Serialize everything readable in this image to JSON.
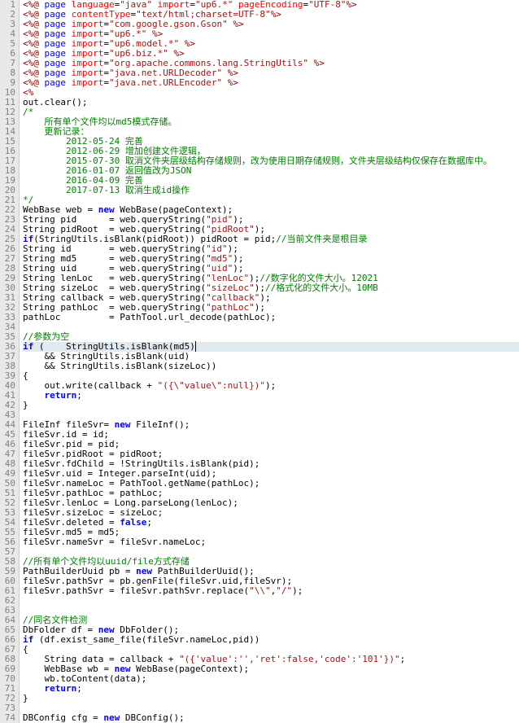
{
  "lines": [
    {
      "n": 1,
      "cls": "",
      "html": "<span class='tag'>&lt;%@</span> <span class='dir'>page</span> <span class='attr'>language</span>=<span class='str'>\"java\"</span> <span class='attr'>import</span>=<span class='str'>\"up6.*\"</span> <span class='attr'>pageEncoding</span>=<span class='str'>\"UTF-8\"</span><span class='tag'>%&gt;</span>"
    },
    {
      "n": 2,
      "cls": "",
      "html": "<span class='tag'>&lt;%@</span> <span class='dir'>page</span> <span class='attr'>contentType</span>=<span class='str'>\"text/html;charset=UTF-8\"</span><span class='tag'>%&gt;</span>"
    },
    {
      "n": 3,
      "cls": "",
      "html": "<span class='tag'>&lt;%@</span> <span class='dir'>page</span> <span class='attr'>import</span>=<span class='str'>\"com.google.gson.Gson\"</span> <span class='tag'>%&gt;</span>"
    },
    {
      "n": 4,
      "cls": "",
      "html": "<span class='tag'>&lt;%@</span> <span class='dir'>page</span> <span class='attr'>import</span>=<span class='str'>\"up6.*\"</span> <span class='tag'>%&gt;</span>"
    },
    {
      "n": 5,
      "cls": "",
      "html": "<span class='tag'>&lt;%@</span> <span class='dir'>page</span> <span class='attr'>import</span>=<span class='str'>\"up6.model.*\"</span> <span class='tag'>%&gt;</span>"
    },
    {
      "n": 6,
      "cls": "",
      "html": "<span class='tag'>&lt;%@</span> <span class='dir'>page</span> <span class='attr'>import</span>=<span class='str'>\"up6.biz.*\"</span> <span class='tag'>%&gt;</span>"
    },
    {
      "n": 7,
      "cls": "",
      "html": "<span class='tag'>&lt;%@</span> <span class='dir'>page</span> <span class='attr'>import</span>=<span class='str'>\"org.apache.commons.lang.StringUtils\"</span> <span class='tag'>%&gt;</span>"
    },
    {
      "n": 8,
      "cls": "",
      "html": "<span class='tag'>&lt;%@</span> <span class='dir'>page</span> <span class='attr'>import</span>=<span class='str'>\"java.net.URLDecoder\"</span> <span class='tag'>%&gt;</span>"
    },
    {
      "n": 9,
      "cls": "",
      "html": "<span class='tag'>&lt;%@</span> <span class='dir'>page</span> <span class='attr'>import</span>=<span class='str'>\"java.net.URLEncoder\"</span> <span class='tag'>%&gt;</span>"
    },
    {
      "n": 10,
      "cls": "",
      "html": "<span class='tag'>&lt;%</span>"
    },
    {
      "n": 11,
      "cls": "",
      "html": "out.clear();"
    },
    {
      "n": 12,
      "cls": "",
      "html": "<span class='cm'>/*</span>"
    },
    {
      "n": 13,
      "cls": "",
      "html": "<span class='cm'>    所有单个文件均以md5模式存储。</span>"
    },
    {
      "n": 14,
      "cls": "",
      "html": "<span class='cm'>    更新记录：</span>"
    },
    {
      "n": 15,
      "cls": "",
      "html": "<span class='cm'>        2012-05-24 完善</span>"
    },
    {
      "n": 16,
      "cls": "",
      "html": "<span class='cm'>        2012-06-29 增加创建文件逻辑，</span>"
    },
    {
      "n": 17,
      "cls": "",
      "html": "<span class='cm'>        2015-07-30 取消文件夹层级结构存储规则，改为使用日期存储规则，文件夹层级结构仅保存在数据库中。</span>"
    },
    {
      "n": 18,
      "cls": "",
      "html": "<span class='cm'>        2016-01-07 返回值改为JSON</span>"
    },
    {
      "n": 19,
      "cls": "",
      "html": "<span class='cm'>        2016-04-09 完善</span>"
    },
    {
      "n": 20,
      "cls": "",
      "html": "<span class='cm'>        2017-07-13 取消生成id操作</span>"
    },
    {
      "n": 21,
      "cls": "",
      "html": "<span class='cm'>*/</span>"
    },
    {
      "n": 22,
      "cls": "",
      "html": "WebBase web = <span class='kw'>new</span> WebBase(pageContext);"
    },
    {
      "n": 23,
      "cls": "",
      "html": "String pid      = web.queryString(<span class='str'>\"pid\"</span>);"
    },
    {
      "n": 24,
      "cls": "",
      "html": "String pidRoot  = web.queryString(<span class='str'>\"pidRoot\"</span>);"
    },
    {
      "n": 25,
      "cls": "",
      "html": "<span class='kw'>if</span>(StringUtils.isBlank(pidRoot)) pidRoot = pid;<span class='cm'>//当前文件夹是根目录</span>"
    },
    {
      "n": 26,
      "cls": "",
      "html": "String id       = web.queryString(<span class='str'>\"id\"</span>);"
    },
    {
      "n": 27,
      "cls": "",
      "html": "String md5      = web.queryString(<span class='str'>\"md5\"</span>);"
    },
    {
      "n": 28,
      "cls": "",
      "html": "String uid      = web.queryString(<span class='str'>\"uid\"</span>);"
    },
    {
      "n": 29,
      "cls": "",
      "html": "String lenLoc   = web.queryString(<span class='str'>\"lenLoc\"</span>);<span class='cm'>//数字化的文件大小。12021</span>"
    },
    {
      "n": 30,
      "cls": "",
      "html": "String sizeLoc  = web.queryString(<span class='str'>\"sizeLoc\"</span>);<span class='cm'>//格式化的文件大小。10MB</span>"
    },
    {
      "n": 31,
      "cls": "",
      "html": "String callback = web.queryString(<span class='str'>\"callback\"</span>);"
    },
    {
      "n": 32,
      "cls": "",
      "html": "String pathLoc  = web.queryString(<span class='str'>\"pathLoc\"</span>);"
    },
    {
      "n": 33,
      "cls": "",
      "html": "pathLoc         = PathTool.url_decode(pathLoc);"
    },
    {
      "n": 34,
      "cls": "",
      "html": ""
    },
    {
      "n": 35,
      "cls": "",
      "html": "<span class='cm'>//参数为空</span>"
    },
    {
      "n": 36,
      "cls": "hl",
      "html": "<span class='kw'>if</span> (    StringUtils.isBlank(md5)<span style='border-left:1px solid #000'></span>"
    },
    {
      "n": 37,
      "cls": "",
      "html": "    &amp;&amp; StringUtils.isBlank(uid)"
    },
    {
      "n": 38,
      "cls": "",
      "html": "    &amp;&amp; StringUtils.isBlank(sizeLoc))"
    },
    {
      "n": 39,
      "cls": "",
      "html": "{"
    },
    {
      "n": 40,
      "cls": "",
      "html": "    out.write(callback + <span class='str'>\"({\\\"value\\\":null})\"</span>);"
    },
    {
      "n": 41,
      "cls": "",
      "html": "    <span class='kw'>return</span>;"
    },
    {
      "n": 42,
      "cls": "",
      "html": "}"
    },
    {
      "n": 43,
      "cls": "",
      "html": ""
    },
    {
      "n": 44,
      "cls": "",
      "html": "FileInf fileSvr= <span class='kw'>new</span> FileInf();"
    },
    {
      "n": 45,
      "cls": "",
      "html": "fileSvr.id = id;"
    },
    {
      "n": 46,
      "cls": "",
      "html": "fileSvr.pid = pid;"
    },
    {
      "n": 47,
      "cls": "",
      "html": "fileSvr.pidRoot = pidRoot;"
    },
    {
      "n": 48,
      "cls": "",
      "html": "fileSvr.fdChild = !StringUtils.isBlank(pid);"
    },
    {
      "n": 49,
      "cls": "",
      "html": "fileSvr.uid = Integer.parseInt(uid);"
    },
    {
      "n": 50,
      "cls": "",
      "html": "fileSvr.nameLoc = PathTool.getName(pathLoc);"
    },
    {
      "n": 51,
      "cls": "",
      "html": "fileSvr.pathLoc = pathLoc;"
    },
    {
      "n": 52,
      "cls": "",
      "html": "fileSvr.lenLoc = Long.parseLong(lenLoc);"
    },
    {
      "n": 53,
      "cls": "",
      "html": "fileSvr.sizeLoc = sizeLoc;"
    },
    {
      "n": 54,
      "cls": "",
      "html": "fileSvr.deleted = <span class='kw'>false</span>;"
    },
    {
      "n": 55,
      "cls": "",
      "html": "fileSvr.md5 = md5;"
    },
    {
      "n": 56,
      "cls": "",
      "html": "fileSvr.nameSvr = fileSvr.nameLoc;"
    },
    {
      "n": 57,
      "cls": "",
      "html": ""
    },
    {
      "n": 58,
      "cls": "",
      "html": "<span class='cm'>//所有单个文件均以uuid/file方式存储</span>"
    },
    {
      "n": 59,
      "cls": "",
      "html": "PathBuilderUuid pb = <span class='kw'>new</span> PathBuilderUuid();"
    },
    {
      "n": 60,
      "cls": "",
      "html": "fileSvr.pathSvr = pb.genFile(fileSvr.uid,fileSvr);"
    },
    {
      "n": 61,
      "cls": "",
      "html": "fileSvr.pathSvr = fileSvr.pathSvr.replace(<span class='str'>\"\\\\\"</span>,<span class='str'>\"/\"</span>);"
    },
    {
      "n": 62,
      "cls": "",
      "html": ""
    },
    {
      "n": 63,
      "cls": "",
      "html": ""
    },
    {
      "n": 64,
      "cls": "",
      "html": "<span class='cm'>//同名文件检测</span>"
    },
    {
      "n": 65,
      "cls": "",
      "html": "DbFolder df = <span class='kw'>new</span> DbFolder();"
    },
    {
      "n": 66,
      "cls": "",
      "html": "<span class='kw'>if</span> (df.exist_same_file(fileSvr.nameLoc,pid))"
    },
    {
      "n": 67,
      "cls": "",
      "html": "{"
    },
    {
      "n": 68,
      "cls": "",
      "html": "    String data = callback + <span class='str'>\"({'value':'','ret':false,'code':'101'})\"</span>;"
    },
    {
      "n": 69,
      "cls": "",
      "html": "    WebBase wb = <span class='kw'>new</span> WebBase(pageContext);"
    },
    {
      "n": 70,
      "cls": "",
      "html": "    wb.toContent(data);"
    },
    {
      "n": 71,
      "cls": "",
      "html": "    <span class='kw'>return</span>;"
    },
    {
      "n": 72,
      "cls": "",
      "html": "}"
    },
    {
      "n": 73,
      "cls": "",
      "html": ""
    },
    {
      "n": 74,
      "cls": "",
      "html": "DBConfig cfg = <span class='kw'>new</span> DBConfig();"
    }
  ]
}
